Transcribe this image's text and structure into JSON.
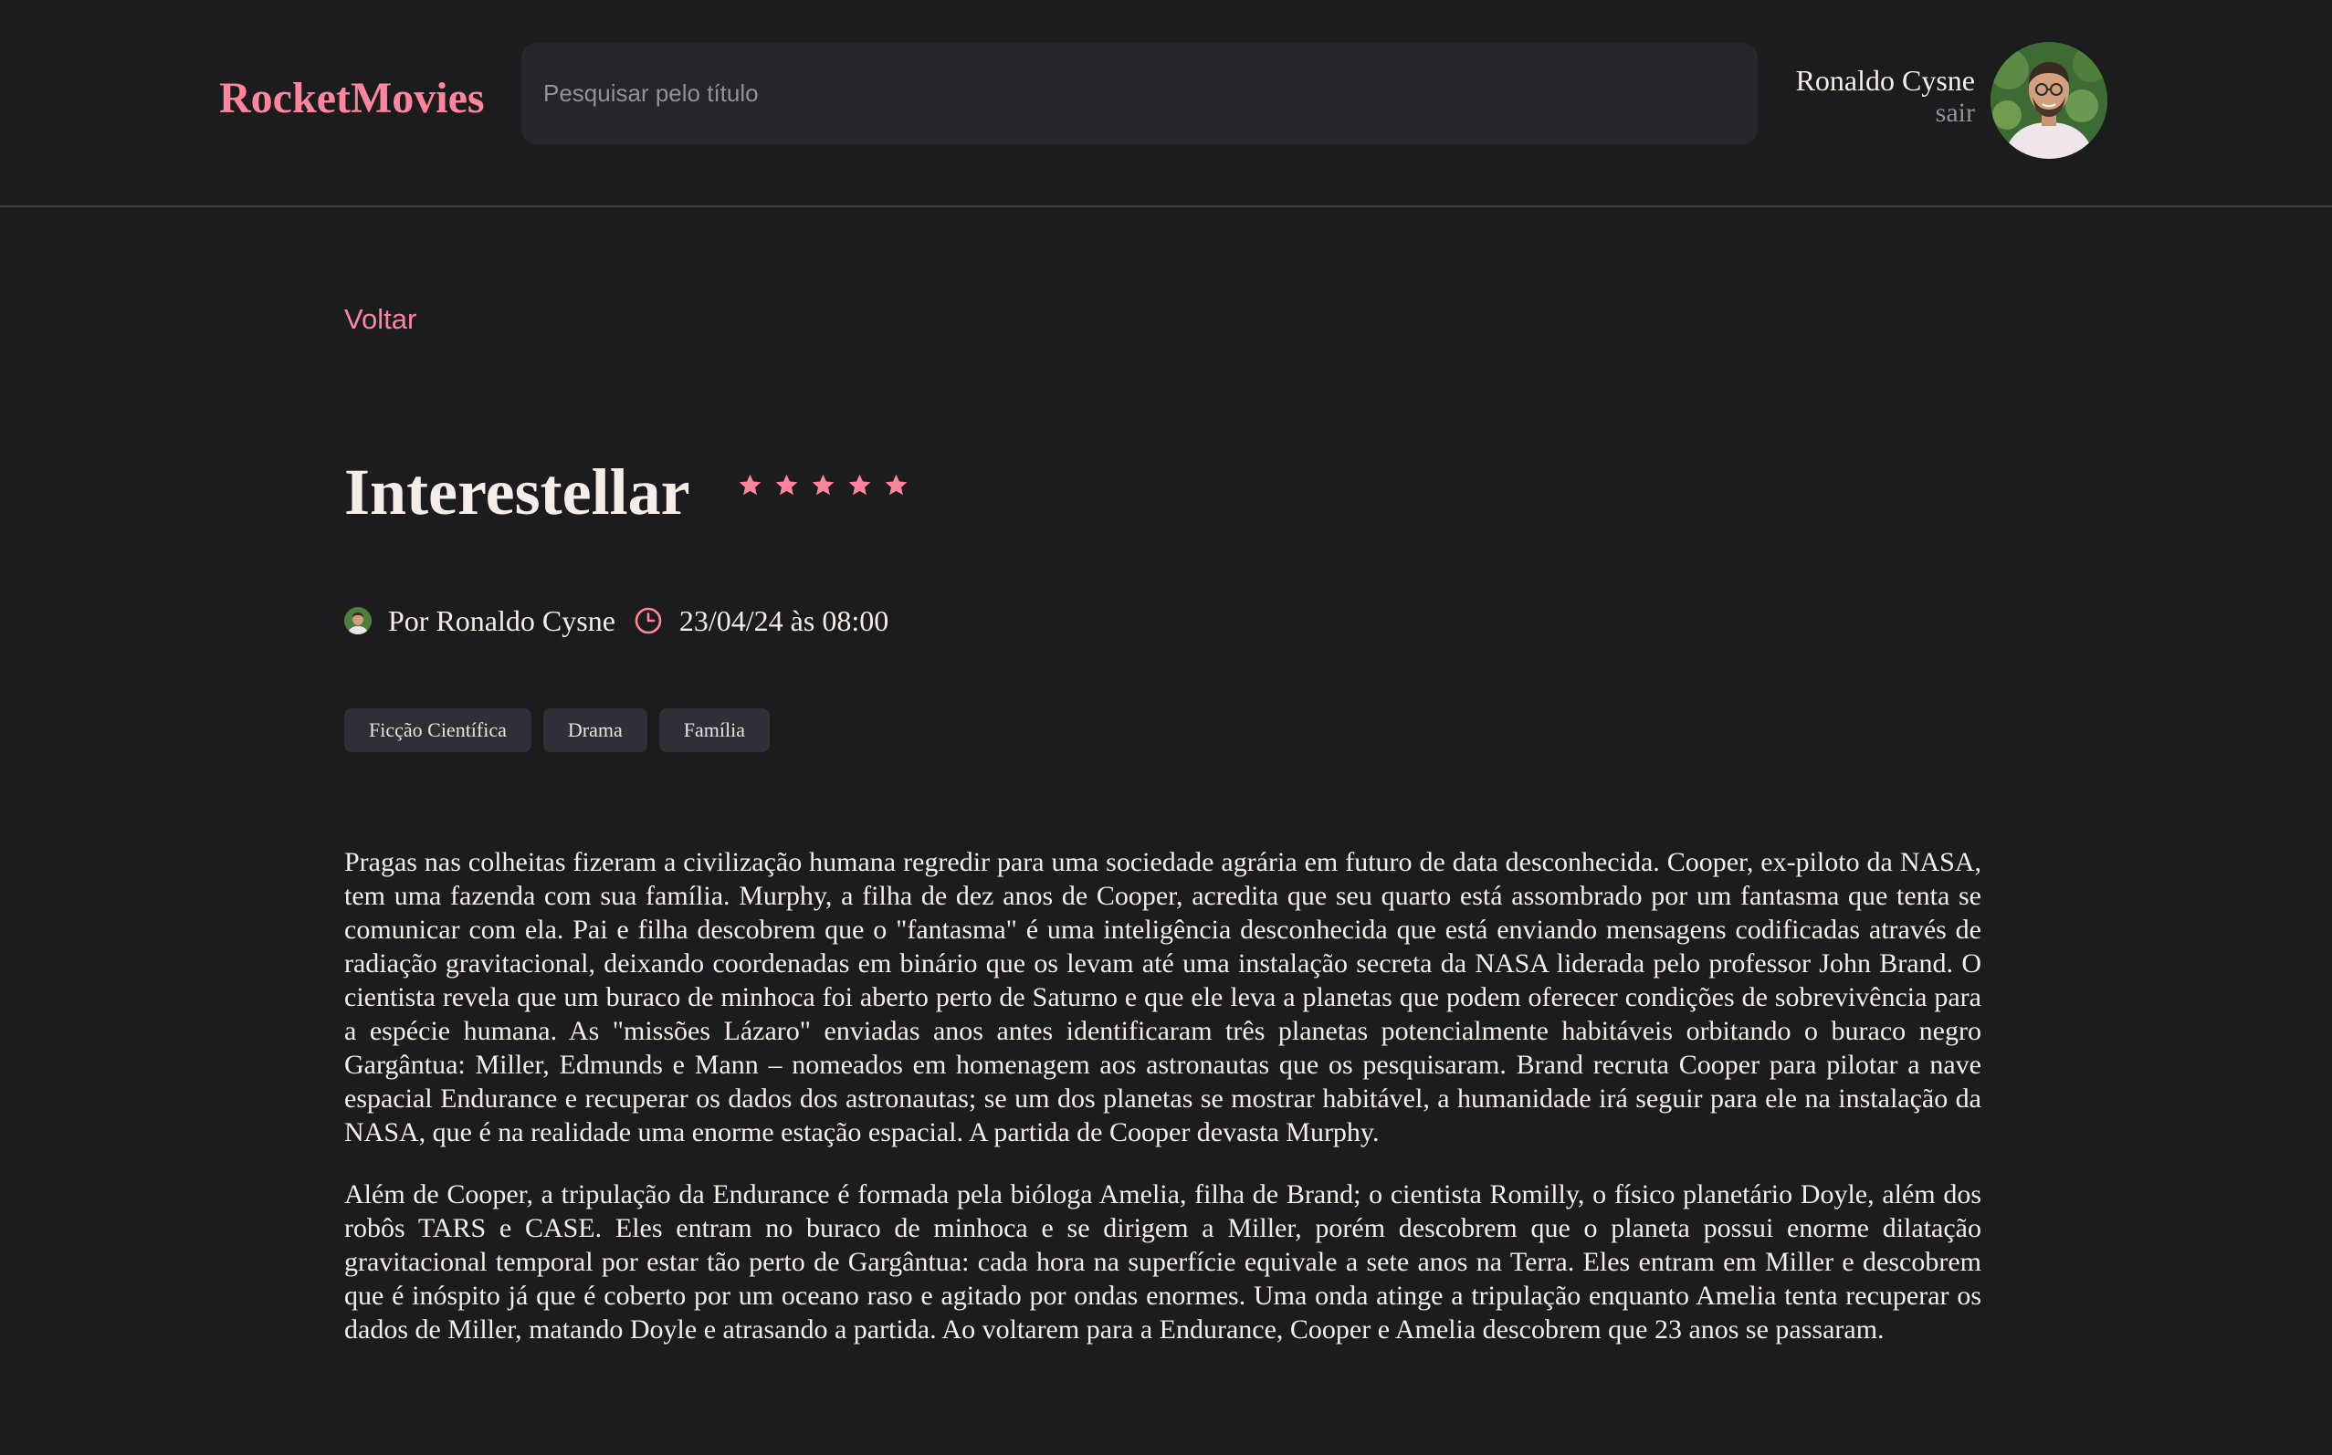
{
  "header": {
    "brand": "RocketMovies",
    "search": {
      "placeholder": "Pesquisar pelo título",
      "value": ""
    },
    "profile": {
      "name": "Ronaldo Cysne",
      "signout_label": "sair"
    }
  },
  "nav": {
    "back_label": "Voltar"
  },
  "movie": {
    "title": "Interestellar",
    "rating": {
      "value": 5,
      "max": 5
    },
    "author_label": "Por Ronaldo Cysne",
    "datetime": "23/04/24 às 08:00",
    "tags": [
      "Ficção Científica",
      "Drama",
      "Família"
    ],
    "description": [
      "Pragas nas colheitas fizeram a civilização humana regredir para uma sociedade agrária em futuro de data desconhecida. Cooper, ex-piloto da NASA, tem uma fazenda com sua família. Murphy, a filha de dez anos de Cooper, acredita que seu quarto está assombrado por um fantasma que tenta se comunicar com ela. Pai e filha descobrem que o \"fantasma\" é uma inteligência desconhecida que está enviando mensagens codificadas através de radiação gravitacional, deixando coordenadas em binário que os levam até uma instalação secreta da NASA liderada pelo professor John Brand. O cientista revela que um buraco de minhoca foi aberto perto de Saturno e que ele leva a planetas que podem oferecer condições de sobrevivência para a espécie humana. As \"missões Lázaro\" enviadas anos antes identificaram três planetas potencialmente habitáveis orbitando o buraco negro Gargântua: Miller, Edmunds e Mann – nomeados em homenagem aos astronautas que os pesquisaram. Brand recruta Cooper para pilotar a nave espacial Endurance e recuperar os dados dos astronautas; se um dos planetas se mostrar habitável, a humanidade irá seguir para ele na instalação da NASA, que é na realidade uma enorme estação espacial. A partida de Cooper devasta Murphy.",
      "Além de Cooper, a tripulação da Endurance é formada pela bióloga Amelia, filha de Brand; o cientista Romilly, o físico planetário Doyle, além dos robôs TARS e CASE. Eles entram no buraco de minhoca e se dirigem a Miller, porém descobrem que o planeta possui enorme dilatação gravitacional temporal por estar tão perto de Gargântua: cada hora na superfície equivale a sete anos na Terra. Eles entram em Miller e descobrem que é inóspito já que é coberto por um oceano raso e agitado por ondas enormes. Uma onda atinge a tripulação enquanto Amelia tenta recuperar os dados de Miller, matando Doyle e atrasando a partida. Ao voltarem para a Endurance, Cooper e Amelia descobrem que 23 anos se passaram."
    ]
  },
  "icons": {
    "star": "star-icon",
    "clock": "clock-icon",
    "avatar": "user-photo"
  },
  "colors": {
    "accent": "#ff859b",
    "background": "#1c1b1e",
    "input_bg": "#262529",
    "tag_bg": "#312e38",
    "text": "#f4ede8",
    "muted": "#948f99"
  }
}
